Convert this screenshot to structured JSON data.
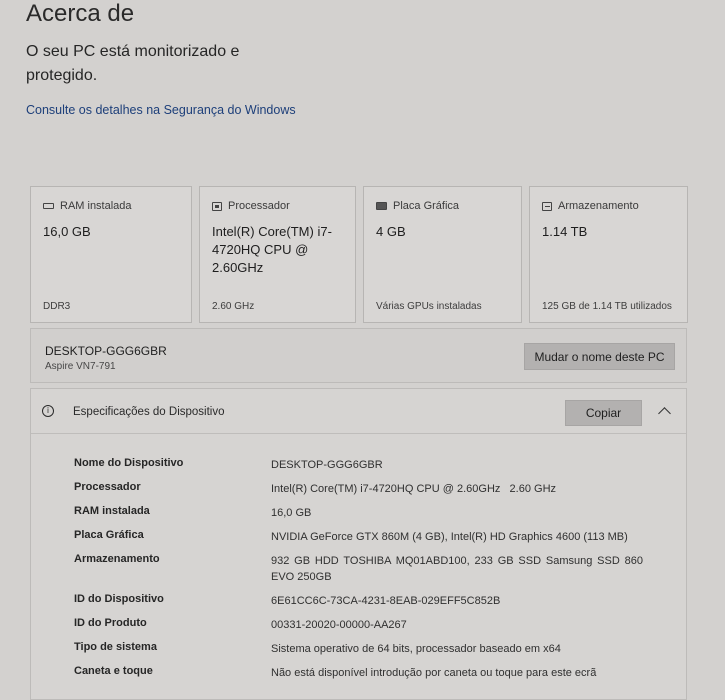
{
  "page": {
    "title": "Acerca de",
    "protection_text": "O seu PC está monitorizado e protegido.",
    "security_link": "Consulte os detalhes na Segurança do Windows"
  },
  "cards": [
    {
      "icon": "ram-icon",
      "label": "RAM instalada",
      "value": "16,0 GB",
      "footer": "DDR3"
    },
    {
      "icon": "processor-icon",
      "label": "Processador",
      "value": "Intel(R) Core(TM) i7-4720HQ CPU @ 2.60GHz",
      "footer": "2.60 GHz"
    },
    {
      "icon": "graphics-card-icon",
      "label": "Placa Gráfica",
      "value": "4 GB",
      "footer": "Várias GPUs instaladas"
    },
    {
      "icon": "storage-icon",
      "label": "Armazenamento",
      "value": "1.14 TB",
      "footer": "125 GB de 1.14 TB utilizados"
    }
  ],
  "pc": {
    "name": "DESKTOP-GGG6GBR",
    "model": "Aspire VN7-791",
    "rename_label": "Mudar o nome deste PC"
  },
  "specs": {
    "title": "Especificações do Dispositivo",
    "copy_label": "Copiar",
    "rows": [
      {
        "label": "Nome do Dispositivo",
        "value": "DESKTOP-GGG6GBR"
      },
      {
        "label": "Processador",
        "value": "Intel(R) Core(TM) i7-4720HQ CPU @ 2.60GHz   2.60 GHz"
      },
      {
        "label": "RAM instalada",
        "value": "16,0 GB"
      },
      {
        "label": "Placa Gráfica",
        "value": "NVIDIA GeForce GTX 860M (4 GB), Intel(R) HD Graphics 4600 (113 MB)"
      },
      {
        "label": "Armazenamento",
        "value": "932 GB HDD TOSHIBA MQ01ABD100, 233 GB SSD Samsung SSD 860 EVO 250GB"
      },
      {
        "label": "ID do Dispositivo",
        "value": "6E61CC6C-73CA-4231-8EAB-029EFF5C852B"
      },
      {
        "label": "ID do Produto",
        "value": "00331-20020-00000-AA267"
      },
      {
        "label": "Tipo de sistema",
        "value": "Sistema operativo de 64 bits, processador baseado em x64"
      },
      {
        "label": "Caneta e toque",
        "value": "Não está disponível introdução por caneta ou toque para este ecrã"
      }
    ]
  }
}
